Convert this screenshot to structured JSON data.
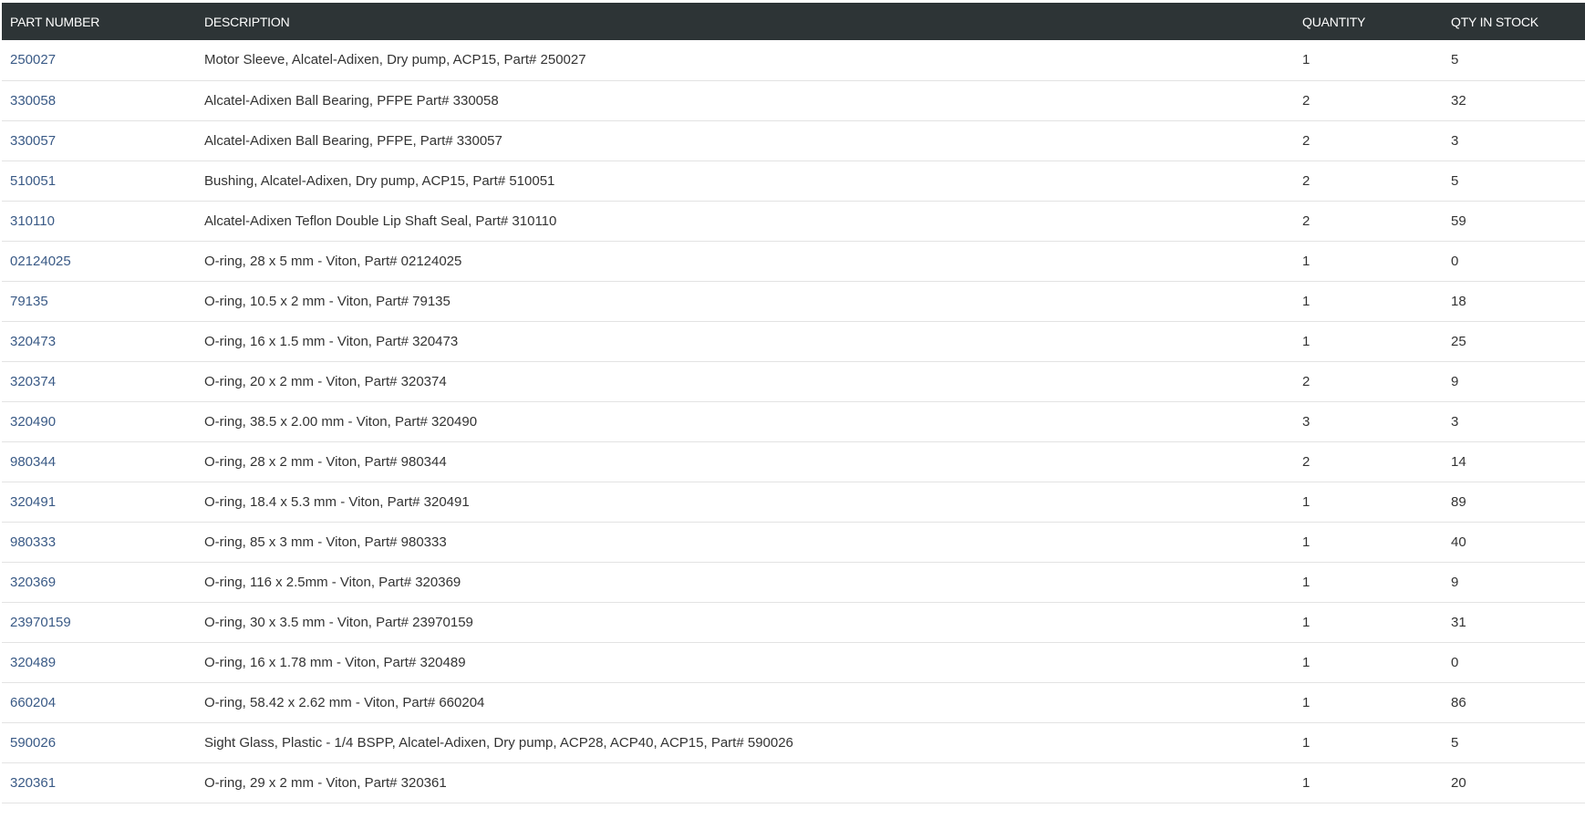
{
  "table": {
    "headers": {
      "part_number": "PART NUMBER",
      "description": "DESCRIPTION",
      "quantity": "QUANTITY",
      "qty_in_stock": "QTY IN STOCK"
    },
    "rows": [
      {
        "part": "250027",
        "desc": "Motor Sleeve, Alcatel-Adixen, Dry pump, ACP15, Part# 250027",
        "qty": "1",
        "stock": "5"
      },
      {
        "part": "330058",
        "desc": "Alcatel-Adixen Ball Bearing, PFPE Part# 330058",
        "qty": "2",
        "stock": "32"
      },
      {
        "part": "330057",
        "desc": "Alcatel-Adixen Ball Bearing, PFPE, Part# 330057",
        "qty": "2",
        "stock": "3"
      },
      {
        "part": "510051",
        "desc": "Bushing, Alcatel-Adixen, Dry pump, ACP15, Part# 510051",
        "qty": "2",
        "stock": "5"
      },
      {
        "part": "310110",
        "desc": "Alcatel-Adixen Teflon Double Lip Shaft Seal, Part# 310110",
        "qty": "2",
        "stock": "59"
      },
      {
        "part": "02124025",
        "desc": "O-ring, 28 x 5 mm - Viton, Part# 02124025",
        "qty": "1",
        "stock": "0"
      },
      {
        "part": "79135",
        "desc": "O-ring, 10.5 x 2 mm - Viton, Part# 79135",
        "qty": "1",
        "stock": "18"
      },
      {
        "part": "320473",
        "desc": "O-ring, 16 x 1.5 mm - Viton, Part# 320473",
        "qty": "1",
        "stock": "25"
      },
      {
        "part": "320374",
        "desc": "O-ring, 20 x 2 mm - Viton, Part# 320374",
        "qty": "2",
        "stock": "9"
      },
      {
        "part": "320490",
        "desc": "O-ring, 38.5 x 2.00 mm - Viton, Part# 320490",
        "qty": "3",
        "stock": "3"
      },
      {
        "part": "980344",
        "desc": "O-ring, 28 x 2 mm - Viton, Part# 980344",
        "qty": "2",
        "stock": "14"
      },
      {
        "part": "320491",
        "desc": "O-ring, 18.4 x 5.3 mm - Viton, Part# 320491",
        "qty": "1",
        "stock": "89"
      },
      {
        "part": "980333",
        "desc": "O-ring, 85 x 3 mm - Viton, Part# 980333",
        "qty": "1",
        "stock": "40"
      },
      {
        "part": "320369",
        "desc": "O-ring, 116 x 2.5mm - Viton, Part# 320369",
        "qty": "1",
        "stock": "9"
      },
      {
        "part": "23970159",
        "desc": "O-ring, 30 x 3.5 mm - Viton, Part# 23970159",
        "qty": "1",
        "stock": "31"
      },
      {
        "part": "320489",
        "desc": "O-ring, 16 x 1.78 mm - Viton, Part# 320489",
        "qty": "1",
        "stock": "0"
      },
      {
        "part": "660204",
        "desc": "O-ring, 58.42 x 2.62 mm - Viton, Part# 660204",
        "qty": "1",
        "stock": "86"
      },
      {
        "part": "590026",
        "desc": "Sight Glass, Plastic - 1/4 BSPP, Alcatel-Adixen, Dry pump, ACP28, ACP40, ACP15, Part# 590026",
        "qty": "1",
        "stock": "5"
      },
      {
        "part": "320361",
        "desc": "O-ring, 29 x 2 mm - Viton, Part# 320361",
        "qty": "1",
        "stock": "20"
      }
    ]
  },
  "colors": {
    "header_bg": "#2d3436",
    "header_text": "#ffffff",
    "link": "#3a5a86",
    "row_divider": "#e3e3e3"
  }
}
